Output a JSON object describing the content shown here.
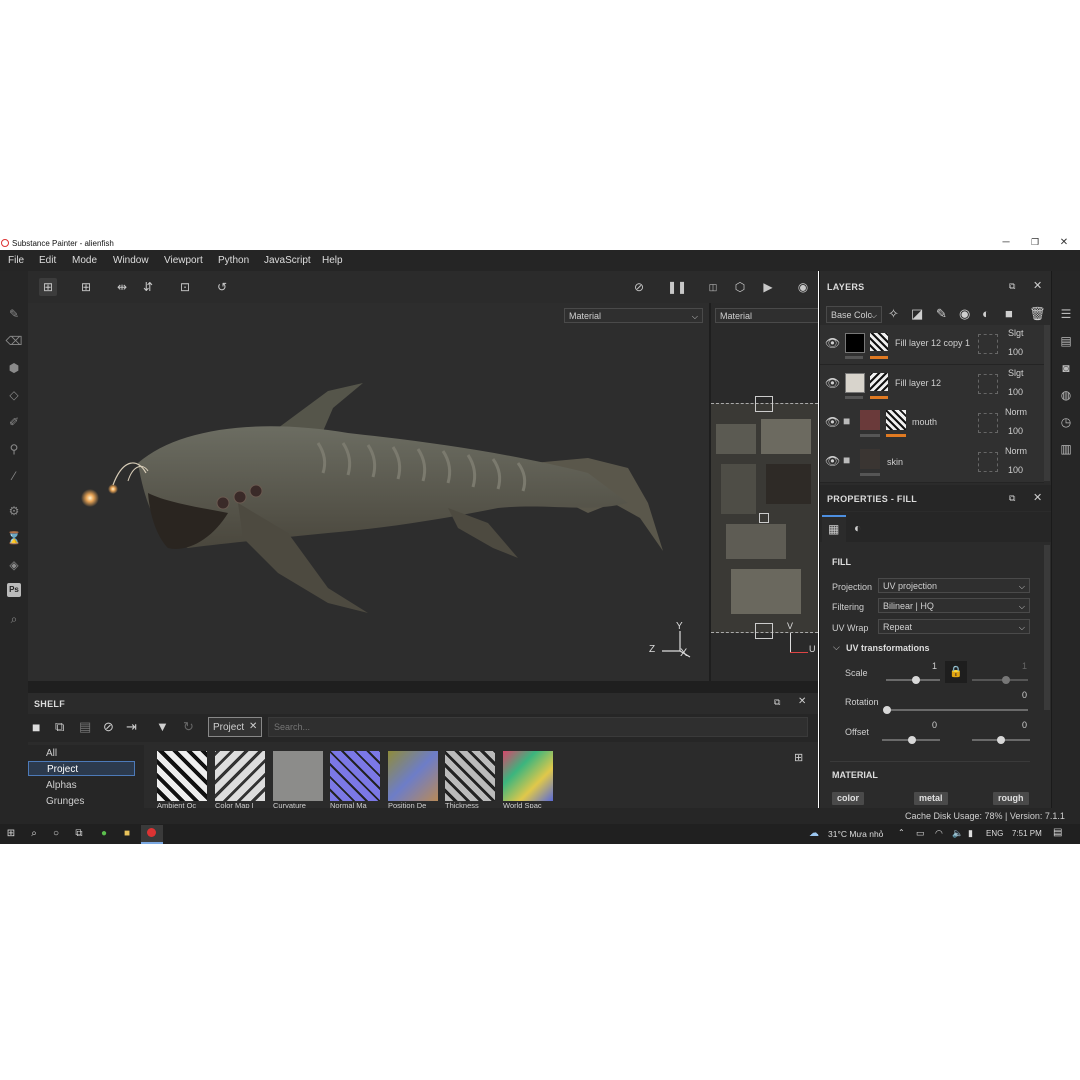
{
  "window": {
    "title": "Substance Painter - alienfish",
    "minimize": "─",
    "restore": "❐",
    "close": "✕"
  },
  "menu": [
    "File",
    "Edit",
    "Mode",
    "Window",
    "Viewport",
    "Python",
    "JavaScript",
    "Help"
  ],
  "viewport": {
    "material_select_3d": "Material",
    "material_select_uv": "Material",
    "axis_y": "Y",
    "axis_z": "Z",
    "axis_x": "X",
    "uv_v": "V",
    "uv_u": "U"
  },
  "layers": {
    "title": "LAYERS",
    "channel_select": "Base Colc",
    "items": [
      {
        "name": "Fill layer 12 copy 1",
        "blend": "Slgt",
        "opacity": "100"
      },
      {
        "name": "Fill layer 12",
        "blend": "Slgt",
        "opacity": "100"
      },
      {
        "name": "mouth",
        "blend": "Norm",
        "opacity": "100"
      },
      {
        "name": "skin",
        "blend": "Norm",
        "opacity": "100"
      }
    ]
  },
  "properties": {
    "title": "PROPERTIES - FILL",
    "fill_header": "FILL",
    "projection_label": "Projection",
    "projection_value": "UV projection",
    "filtering_label": "Filtering",
    "filtering_value": "Bilinear | HQ",
    "uvwrap_label": "UV Wrap",
    "uvwrap_value": "Repeat",
    "uvtrans_header": "UV transformations",
    "scale_label": "Scale",
    "scale_value": "1",
    "scale_value2": "1",
    "rotation_label": "Rotation",
    "rotation_value": "0",
    "offset_label": "Offset",
    "offset_x": "0",
    "offset_y": "0",
    "material_header": "MATERIAL",
    "chips": [
      "color",
      "metal",
      "rough"
    ]
  },
  "shelf": {
    "title": "SHELF",
    "search_tag": "Project",
    "search_placeholder": "Search...",
    "categories": [
      "All",
      "Project",
      "Alphas",
      "Grunges"
    ],
    "selected_category": "Project",
    "thumbnails": [
      "Ambient Oc",
      "Color Map I",
      "Curvature",
      "Normal Ma",
      "Position De",
      "Thickness",
      "World Spac"
    ]
  },
  "status": {
    "text": "Cache Disk Usage: 78% | Version: 7.1.1"
  },
  "taskbar": {
    "weather": "31°C  Mưa nhỏ",
    "lang": "ENG",
    "time": "7:51 PM"
  }
}
